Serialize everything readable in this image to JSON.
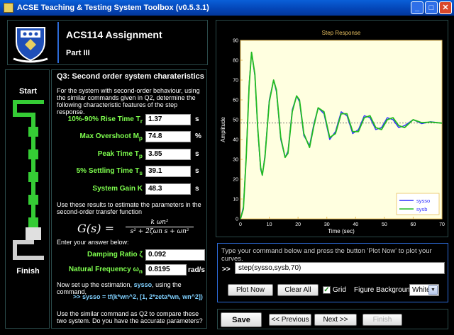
{
  "window": {
    "title": "ACSE Teaching & Testing System Toolbox (v0.5.3.1)"
  },
  "header": {
    "title": "ACS114 Assignment",
    "part": "Part III"
  },
  "progress": {
    "start_label": "Start",
    "finish_label": "Finish",
    "completed_steps": 5,
    "total_steps": 6
  },
  "question": {
    "title": "Q3: Second order system charateristics",
    "intro": "For the system with second-order behaviour, using the similar commands given in Q2, determine the following characteristic features of the step response.",
    "fields": [
      {
        "label": "10%-90% Rise Time T",
        "sub": "r",
        "value": "1.37",
        "unit": "s"
      },
      {
        "label": "Max Overshoot M",
        "sub": "p",
        "value": "74.8",
        "unit": "%"
      },
      {
        "label": "Peak Time T",
        "sub": "p",
        "value": "3.85",
        "unit": "s"
      },
      {
        "label": "5% Settling Time T",
        "sub": "s",
        "value": "39.1",
        "unit": "s"
      },
      {
        "label": "System Gain K",
        "sub": "",
        "value": "48.3",
        "unit": "s"
      }
    ],
    "estimate_text": "Use these results to estimate the parameters in the second-order transfer function",
    "formula": {
      "lhs": "G(s) =",
      "numerator": "k ωn²",
      "denominator": "s² + 2ζωn s + ωn²"
    },
    "answer_prompt": "Enter your answer below:",
    "answers": [
      {
        "label": "Damping Ratio ζ",
        "sub": "",
        "value": "0.092",
        "unit": ""
      },
      {
        "label": "Natural Frequency ω",
        "sub": "n",
        "value": "0.8195",
        "unit": "rad/s"
      }
    ],
    "setup_text_pre": "Now set up the estimation, ",
    "setup_text_var": "sysso",
    "setup_text_post": ", using the command,",
    "command_prompt": ">>",
    "command_text": "sysso = tf(k*wn^2, [1, 2*zeta*wn, wn^2])",
    "compare_text": "Use the similar command as Q2 to compare these two system. Do you have the accurate parameters?"
  },
  "chart_data": {
    "type": "line",
    "title": "Step Response",
    "xlabel": "Time (sec)",
    "ylabel": "Amplitude",
    "xlim": [
      0,
      70
    ],
    "ylim": [
      0,
      90
    ],
    "xticks": [
      0,
      10,
      20,
      30,
      40,
      50,
      60,
      70
    ],
    "yticks": [
      0,
      10,
      20,
      30,
      40,
      50,
      60,
      70,
      80,
      90
    ],
    "grid": false,
    "legend": "bottom-right",
    "reference_line_y": 48.3,
    "series": [
      {
        "name": "sysso",
        "color": "#3030ff",
        "x": [
          0,
          1,
          2,
          3,
          3.85,
          5,
          6,
          7,
          7.6,
          8.5,
          10,
          11.5,
          12.5,
          14,
          15.5,
          16.5,
          18,
          19.5,
          20.5,
          22,
          24,
          25.5,
          27,
          29,
          31,
          33,
          35,
          37,
          39,
          41,
          43,
          45,
          47,
          49,
          51,
          53,
          55,
          57,
          60,
          63,
          66,
          70
        ],
        "y": [
          0,
          6,
          32,
          68,
          84,
          72,
          45,
          25,
          22,
          32,
          60,
          70,
          64,
          40,
          31,
          34,
          55,
          62,
          59,
          42,
          37,
          48,
          56,
          53,
          40,
          44,
          54,
          52,
          43,
          45,
          52,
          51,
          45,
          46,
          51,
          50,
          46,
          47,
          50,
          48,
          49,
          48.3
        ]
      },
      {
        "name": "sysb",
        "color": "#22bb22",
        "x": [
          0,
          1,
          2,
          3,
          3.85,
          5,
          6,
          7,
          7.6,
          8.5,
          10,
          11.5,
          12.5,
          14,
          15.5,
          16.5,
          18,
          19.5,
          20.5,
          22,
          24,
          25.5,
          27,
          29,
          31,
          33,
          35,
          37,
          39,
          41,
          43,
          45,
          47,
          49,
          51,
          53,
          55,
          57,
          60,
          63,
          66,
          70
        ],
        "y": [
          0,
          5,
          31,
          67,
          84,
          73,
          46,
          26,
          22,
          31,
          59,
          70,
          65,
          41,
          31,
          33,
          54,
          62,
          60,
          43,
          36,
          47,
          56,
          54,
          41,
          43,
          53,
          53,
          44,
          44,
          51,
          52,
          46,
          45,
          50,
          51,
          47,
          46,
          50,
          48.5,
          48.8,
          48.3
        ]
      }
    ]
  },
  "command_panel": {
    "instruction": "Type your command below and press the button 'Plot Now' to plot your curves.",
    "prompt": ">>",
    "command_value": "step(sysso,sysb,70)",
    "plot_now_label": "Plot Now",
    "clear_all_label": "Clear All",
    "grid_label": "Grid",
    "grid_checked": true,
    "bg_label": "Figure Background:",
    "bg_value": "White"
  },
  "nav": {
    "save_label": "Save",
    "prev_label": "<< Previous",
    "next_label": "Next >>",
    "finish_label": "Finish"
  },
  "colors": {
    "accent": "#7fff4f",
    "axis": "#e8c060",
    "plot_bg": "#ffffe0",
    "frame": "#2d6bd8"
  }
}
